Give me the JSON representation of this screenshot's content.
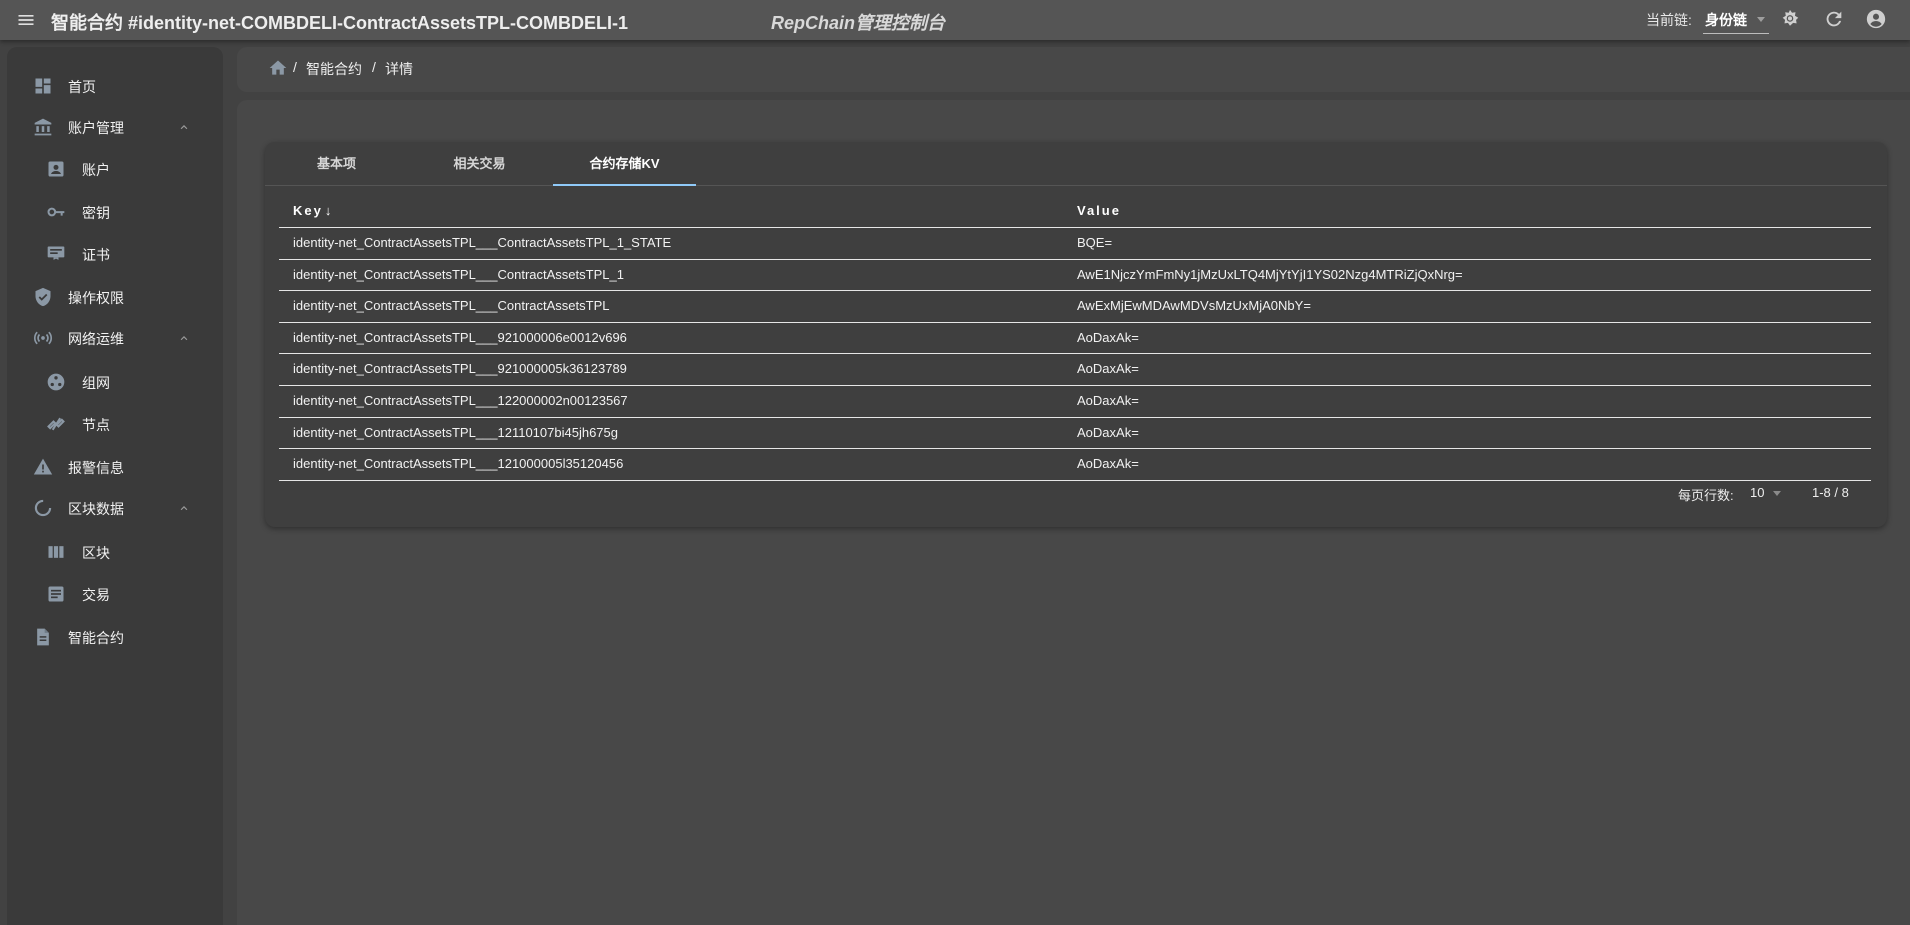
{
  "header": {
    "title": "智能合约 #identity-net-COMBDELI-ContractAssetsTPL-COMBDELI-1",
    "brand": "RepChain管理控制台",
    "chain_label": "当前链:",
    "chain_value": "身份链",
    "icons": [
      "menu-icon",
      "brightness-icon",
      "refresh-icon",
      "account-circle-icon"
    ]
  },
  "sidebar": {
    "items": [
      {
        "label": "首页",
        "icon": "dashboard-icon"
      },
      {
        "label": "账户管理",
        "icon": "bank-icon",
        "expanded": true
      },
      {
        "label": "账户",
        "icon": "account-box-icon"
      },
      {
        "label": "密钥",
        "icon": "key-icon"
      },
      {
        "label": "证书",
        "icon": "certificate-icon"
      },
      {
        "label": "操作权限",
        "icon": "shield-check-icon"
      },
      {
        "label": "网络运维",
        "icon": "access-point-icon",
        "expanded": true
      },
      {
        "label": "组网",
        "icon": "network-icon"
      },
      {
        "label": "节点",
        "icon": "node-link-icon"
      },
      {
        "label": "报警信息",
        "icon": "alert-icon"
      },
      {
        "label": "区块数据",
        "icon": "progress-icon",
        "expanded": true
      },
      {
        "label": "区块",
        "icon": "blocks-icon"
      },
      {
        "label": "交易",
        "icon": "list-box-icon"
      },
      {
        "label": "智能合约",
        "icon": "contract-file-icon"
      }
    ]
  },
  "breadcrumb": {
    "sep1": "/",
    "item1": "智能合约",
    "sep2": "/",
    "item2": "详情"
  },
  "tabs": [
    "基本项",
    "相关交易",
    "合约存储KV"
  ],
  "active_tab": 2,
  "table": {
    "headers": {
      "key": "Key",
      "key_sort": "↓",
      "value": "Value"
    },
    "rows": [
      {
        "key": "identity-net_ContractAssetsTPL___ContractAssetsTPL_1_STATE",
        "value": "BQE="
      },
      {
        "key": "identity-net_ContractAssetsTPL___ContractAssetsTPL_1",
        "value": "AwE1NjczYmFmNy1jMzUxLTQ4MjYtYjI1YS02Nzg4MTRiZjQxNrg="
      },
      {
        "key": "identity-net_ContractAssetsTPL___ContractAssetsTPL",
        "value": "AwExMjEwMDAwMDVsMzUxMjA0NbY="
      },
      {
        "key": "identity-net_ContractAssetsTPL___921000006e0012v696",
        "value": "AoDaxAk="
      },
      {
        "key": "identity-net_ContractAssetsTPL___921000005k36123789",
        "value": "AoDaxAk="
      },
      {
        "key": "identity-net_ContractAssetsTPL___122000002n00123567",
        "value": "AoDaxAk="
      },
      {
        "key": "identity-net_ContractAssetsTPL___12110107bi45jh675g",
        "value": "AoDaxAk="
      },
      {
        "key": "identity-net_ContractAssetsTPL___121000005l35120456",
        "value": "AoDaxAk="
      }
    ]
  },
  "pagination": {
    "rows_per_page_label": "每页行数:",
    "rows_per_page": "10",
    "range": "1-8 / 8"
  }
}
